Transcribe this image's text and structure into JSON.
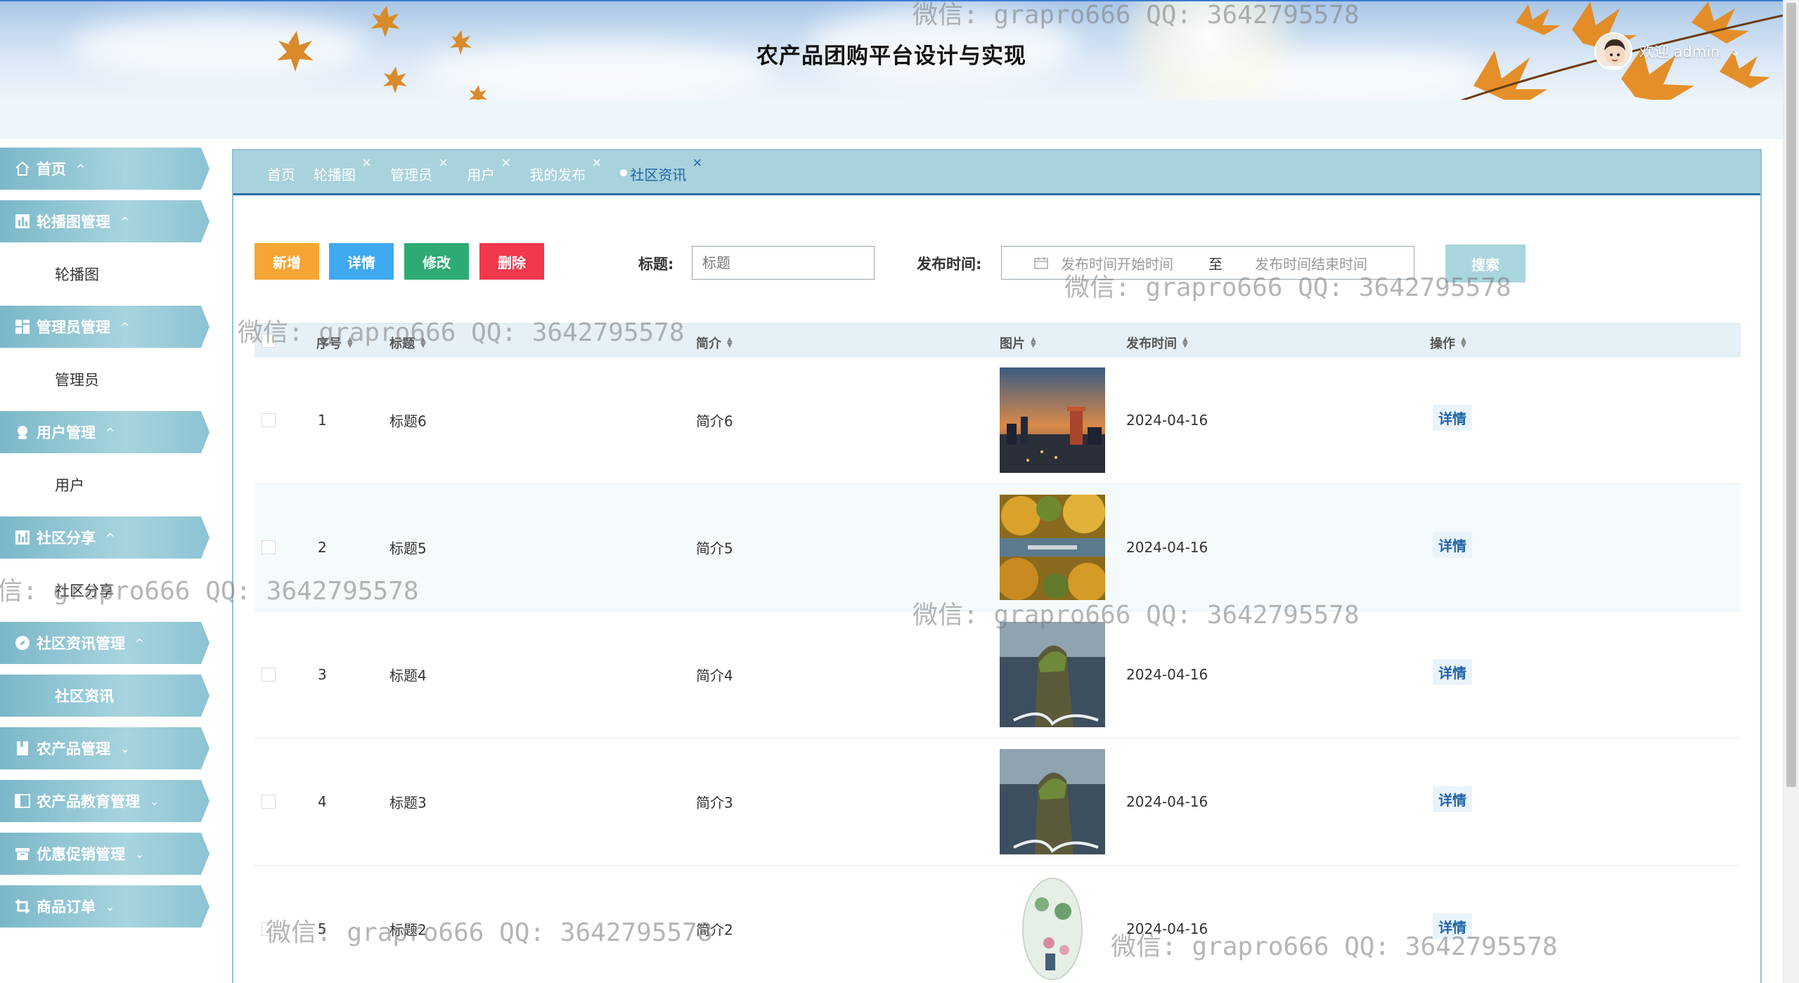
{
  "header": {
    "title": "农产品团购平台设计与实现",
    "welcome": "欢迎 admin"
  },
  "sidebar": {
    "groups": [
      {
        "label": "首页",
        "icon": "home-icon",
        "caret": "^",
        "items": []
      },
      {
        "label": "轮播图管理",
        "icon": "chart-icon",
        "caret": "^",
        "items": [
          {
            "label": "轮播图"
          }
        ]
      },
      {
        "label": "管理员管理",
        "icon": "grid-icon",
        "caret": "^",
        "items": [
          {
            "label": "管理员"
          }
        ]
      },
      {
        "label": "用户管理",
        "icon": "user-icon",
        "caret": "^",
        "items": [
          {
            "label": "用户"
          }
        ]
      },
      {
        "label": "社区分享",
        "icon": "chart-icon",
        "caret": "^",
        "items": [
          {
            "label": "社区分享"
          }
        ]
      },
      {
        "label": "社区资讯管理",
        "icon": "compass-icon",
        "caret": "^",
        "items": [
          {
            "label": "社区资讯",
            "active": true
          }
        ]
      },
      {
        "label": "农产品管理",
        "icon": "book-icon",
        "caret": "v",
        "items": []
      },
      {
        "label": "农产品教育管理",
        "icon": "panel-icon",
        "caret": "v",
        "items": []
      },
      {
        "label": "优惠促销管理",
        "icon": "box-icon",
        "caret": "v",
        "items": []
      },
      {
        "label": "商品订单",
        "icon": "crop-icon",
        "caret": "v",
        "items": []
      }
    ]
  },
  "tabs": [
    {
      "label": "首页",
      "closable": false
    },
    {
      "label": "轮播图",
      "closable": true
    },
    {
      "label": "管理员",
      "closable": true
    },
    {
      "label": "用户",
      "closable": true
    },
    {
      "label": "我的发布",
      "closable": true
    },
    {
      "label": "社区资讯",
      "closable": true,
      "active": true
    }
  ],
  "toolbar": {
    "add": "新增",
    "detail": "详情",
    "edit": "修改",
    "delete": "删除",
    "title_label": "标题:",
    "title_placeholder": "标题",
    "date_label": "发布时间:",
    "date_start_placeholder": "发布时间开始时间",
    "date_to": "至",
    "date_end_placeholder": "发布时间结束时间",
    "search": "搜索"
  },
  "table": {
    "columns": [
      "序号",
      "标题",
      "简介",
      "图片",
      "发布时间",
      "操作"
    ],
    "rows": [
      {
        "no": "1",
        "title": "标题6",
        "intro": "简介6",
        "image": "city-dusk",
        "date": "2024-04-16",
        "action": "详情"
      },
      {
        "no": "2",
        "title": "标题5",
        "intro": "简介5",
        "image": "autumn-river",
        "date": "2024-04-16",
        "action": "详情"
      },
      {
        "no": "3",
        "title": "标题4",
        "intro": "简介4",
        "image": "sea-rock",
        "date": "2024-04-16",
        "action": "详情"
      },
      {
        "no": "4",
        "title": "标题3",
        "intro": "简介3",
        "image": "sea-rock",
        "date": "2024-04-16",
        "action": "详情"
      },
      {
        "no": "5",
        "title": "标题2",
        "intro": "简介2",
        "image": "painted-egg",
        "date": "2024-04-16",
        "action": "详情"
      }
    ]
  },
  "watermark": "微信: grapro666 QQ: 3642795578",
  "colors": {
    "add": "#f5a534",
    "detail": "#3fa9f0",
    "edit": "#2eaa74",
    "delete": "#f2384c",
    "search": "#a9d5de",
    "menu": "#8cc3d3",
    "accent": "#1f64a8"
  }
}
